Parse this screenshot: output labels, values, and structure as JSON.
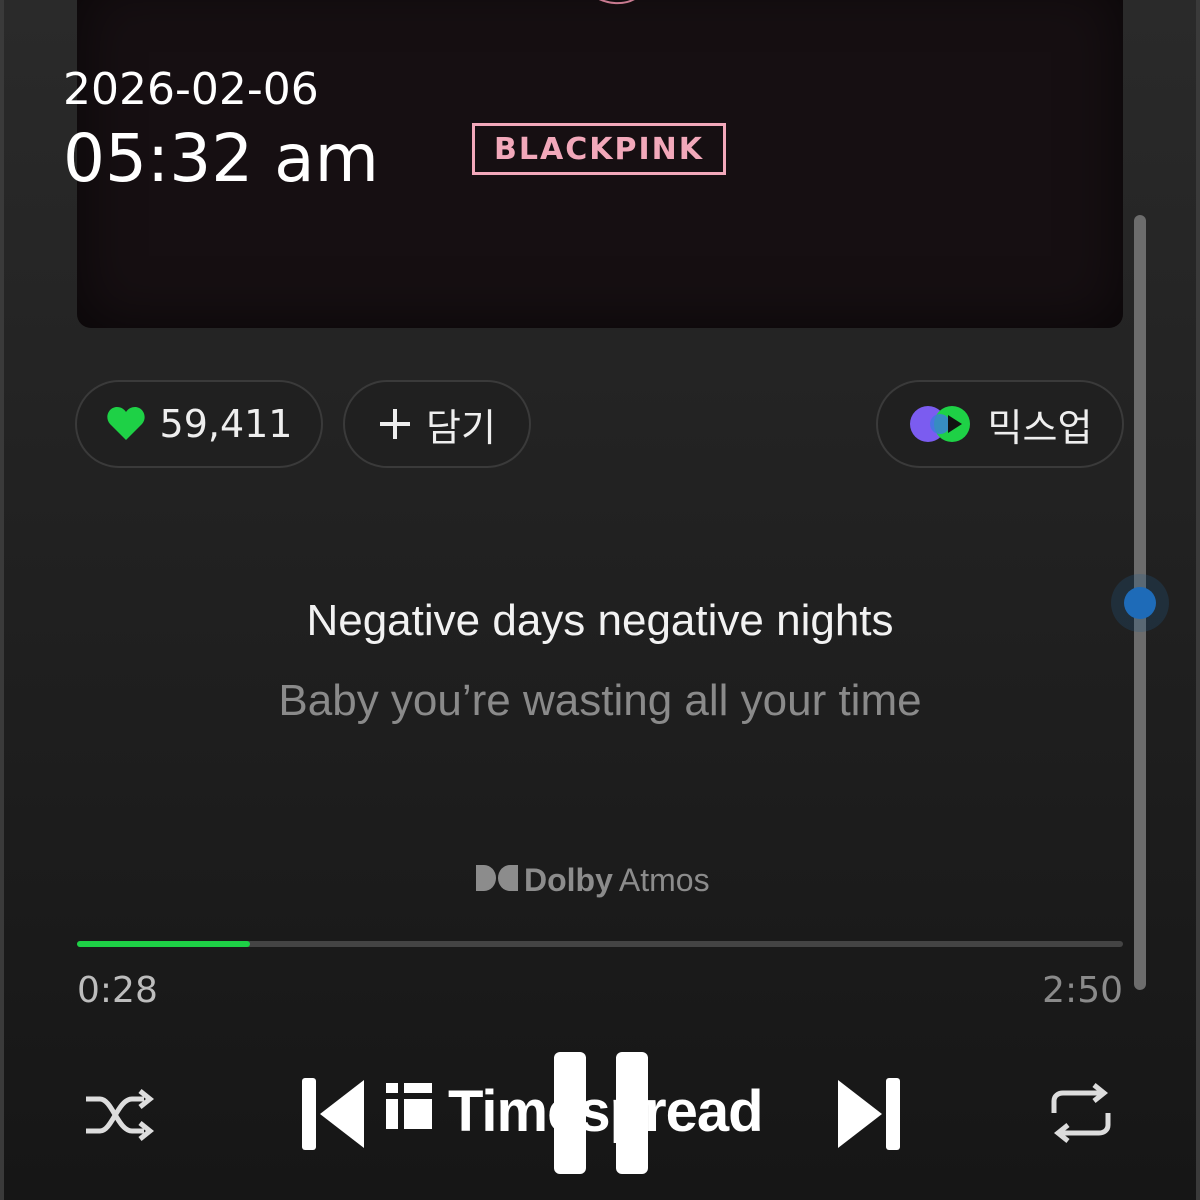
{
  "clock": {
    "date": "2026-02-06",
    "time": "05:32 am"
  },
  "album": {
    "logo_text": "BLACKPINK",
    "logo_color": "#f2a8ba"
  },
  "actions": {
    "like_count": "59,411",
    "add_label": "담기",
    "mix_label": "믹스업"
  },
  "lyrics": {
    "current": "Negative days negative nights",
    "next": "Baby you’re wasting all your time"
  },
  "audio_badge": {
    "brand": "Dolby",
    "mode": "Atmos"
  },
  "playback": {
    "current_time": "0:28",
    "total_time": "2:50",
    "progress_fraction": 0.165,
    "state": "playing"
  },
  "watermark": {
    "text": "Timespread"
  },
  "colors": {
    "accent": "#1ed146",
    "background": "#1a1a1a"
  },
  "icons": [
    "heart-icon",
    "plus-icon",
    "mixup-icon",
    "shuffle-icon",
    "previous-icon",
    "pause-icon",
    "next-icon",
    "repeat-icon"
  ]
}
